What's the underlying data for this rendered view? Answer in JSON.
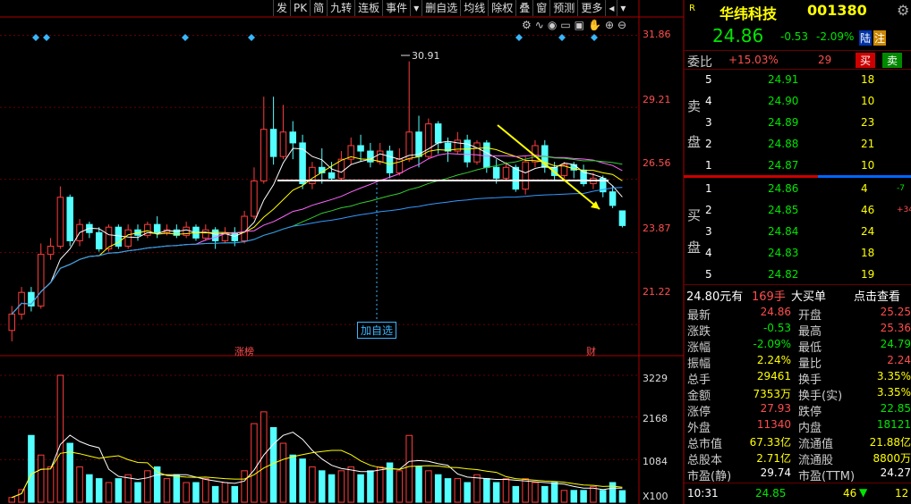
{
  "toolbar": {
    "items": [
      "发",
      "PK",
      "简",
      "九转",
      "连板",
      "事件",
      "▾",
      "删自选",
      "均线",
      "除权",
      "叠",
      "窗",
      "预测",
      "更多",
      "◂",
      "▾"
    ]
  },
  "chart_icons": [
    "gear-icon",
    "wave-icon",
    "eye-icon",
    "ruler-icon",
    "tool-icon",
    "hand-icon",
    "plus-icon",
    "minus-icon"
  ],
  "price_axis": [
    "31.86",
    "29.21",
    "26.56",
    "23.87",
    "21.22"
  ],
  "volume_axis": [
    "3229",
    "2168",
    "1084",
    "X100"
  ],
  "annotations": {
    "high_label": "30.91",
    "add_watch": "加自选",
    "limit_up": "涨榜",
    "finance": "财"
  },
  "stock": {
    "badge": "R",
    "name": "华纬科技",
    "code": "001380",
    "price": "24.86",
    "change": "-0.53",
    "pct": "-2.09%",
    "tag1": "陆",
    "tag2": "注"
  },
  "weibi": {
    "label": "委比",
    "value": "+15.03%",
    "diff": "29",
    "buy_btn": "买",
    "sell_btn": "卖"
  },
  "sell_label": [
    "卖",
    "盘"
  ],
  "buy_label": [
    "买",
    "盘"
  ],
  "sell_orders": [
    {
      "lvl": "5",
      "price": "24.91",
      "vol": "18"
    },
    {
      "lvl": "4",
      "price": "24.90",
      "vol": "10"
    },
    {
      "lvl": "3",
      "price": "24.89",
      "vol": "23"
    },
    {
      "lvl": "2",
      "price": "24.88",
      "vol": "21"
    },
    {
      "lvl": "1",
      "price": "24.87",
      "vol": "10"
    }
  ],
  "buy_orders": [
    {
      "lvl": "1",
      "price": "24.86",
      "vol": "4",
      "extra": "-7"
    },
    {
      "lvl": "2",
      "price": "24.85",
      "vol": "46",
      "extra": "+34"
    },
    {
      "lvl": "3",
      "price": "24.84",
      "vol": "24",
      "extra": ""
    },
    {
      "lvl": "4",
      "price": "24.83",
      "vol": "18",
      "extra": ""
    },
    {
      "lvl": "5",
      "price": "24.82",
      "vol": "19",
      "extra": ""
    }
  ],
  "big_order": {
    "price": "24.80元有",
    "qty": "169手",
    "type": "大买单",
    "link": "点击查看"
  },
  "stats": [
    {
      "k1": "最新",
      "v1": "24.86",
      "c1": "red",
      "k2": "开盘",
      "v2": "25.25",
      "c2": "red"
    },
    {
      "k1": "涨跌",
      "v1": "-0.53",
      "c1": "grn",
      "k2": "最高",
      "v2": "25.36",
      "c2": "red"
    },
    {
      "k1": "涨幅",
      "v1": "-2.09%",
      "c1": "grn",
      "k2": "最低",
      "v2": "24.79",
      "c2": "grn"
    },
    {
      "k1": "振幅",
      "v1": "2.24%",
      "c1": "yel",
      "k2": "量比",
      "v2": "2.24",
      "c2": "red"
    },
    {
      "k1": "总手",
      "v1": "29461",
      "c1": "yel",
      "k2": "换手",
      "v2": "3.35%",
      "c2": "yel"
    },
    {
      "k1": "金额",
      "v1": "7353万",
      "c1": "yel",
      "k2": "换手(实)",
      "v2": "3.35%",
      "c2": "yel"
    },
    {
      "k1": "涨停",
      "v1": "27.93",
      "c1": "red",
      "k2": "跌停",
      "v2": "22.85",
      "c2": "grn"
    },
    {
      "k1": "外盘",
      "v1": "11340",
      "c1": "red",
      "k2": "内盘",
      "v2": "18121",
      "c2": "grn"
    },
    {
      "k1": "总市值",
      "v1": "67.33亿",
      "c1": "yel",
      "k2": "流通值",
      "v2": "21.88亿",
      "c2": "yel"
    },
    {
      "k1": "总股本",
      "v1": "2.71亿",
      "c1": "yel",
      "k2": "流通股",
      "v2": "8800万",
      "c2": "yel"
    },
    {
      "k1": "市盈(静)",
      "v1": "29.74",
      "c1": "wht",
      "k2": "市盈(TTM)",
      "v2": "24.27",
      "c2": "wht"
    }
  ],
  "tick": {
    "time": "10:31",
    "price": "24.85",
    "vol": "46",
    "count": "12"
  },
  "chart_data": {
    "type": "candlestick",
    "ylim": [
      20.5,
      32.5
    ],
    "vol_max": 3229,
    "candles": [
      [
        21.0,
        21.6,
        20.6,
        21.9,
        120
      ],
      [
        21.6,
        22.4,
        21.4,
        22.6,
        320
      ],
      [
        22.4,
        21.9,
        21.7,
        22.6,
        1700
      ],
      [
        21.9,
        23.8,
        21.8,
        24.2,
        1200
      ],
      [
        23.8,
        24.1,
        23.6,
        24.4,
        900
      ],
      [
        24.1,
        25.9,
        24.0,
        26.3,
        3229
      ],
      [
        25.9,
        24.3,
        24.1,
        26.0,
        1500
      ],
      [
        24.3,
        24.9,
        24.1,
        25.1,
        900
      ],
      [
        24.9,
        24.6,
        24.4,
        25.0,
        700
      ],
      [
        24.6,
        24.0,
        23.9,
        24.8,
        600
      ],
      [
        24.0,
        24.8,
        23.9,
        24.9,
        500
      ],
      [
        24.8,
        24.1,
        24.0,
        24.9,
        600
      ],
      [
        24.1,
        24.7,
        24.0,
        24.9,
        700
      ],
      [
        24.7,
        24.5,
        24.3,
        24.9,
        500
      ],
      [
        24.5,
        24.9,
        24.4,
        25.0,
        800
      ],
      [
        24.9,
        24.6,
        24.4,
        25.2,
        900
      ],
      [
        24.6,
        24.7,
        24.5,
        24.9,
        600
      ],
      [
        24.7,
        24.5,
        24.4,
        24.9,
        700
      ],
      [
        24.5,
        24.8,
        24.4,
        25.0,
        500
      ],
      [
        24.8,
        24.4,
        24.3,
        24.9,
        500
      ],
      [
        24.4,
        24.7,
        24.3,
        24.9,
        600
      ],
      [
        24.7,
        24.3,
        24.0,
        24.8,
        400
      ],
      [
        24.3,
        24.6,
        24.2,
        24.8,
        500
      ],
      [
        24.6,
        24.3,
        24.1,
        24.8,
        400
      ],
      [
        24.3,
        25.2,
        24.2,
        25.4,
        800
      ],
      [
        25.2,
        26.5,
        25.1,
        27.0,
        2000
      ],
      [
        26.5,
        28.4,
        26.4,
        29.6,
        2300
      ],
      [
        28.4,
        27.4,
        27.1,
        29.6,
        1900
      ],
      [
        27.4,
        28.3,
        27.3,
        29.3,
        1500
      ],
      [
        28.3,
        27.9,
        27.3,
        28.7,
        1200
      ],
      [
        27.9,
        26.4,
        26.2,
        28.2,
        1100
      ],
      [
        26.4,
        27.0,
        26.2,
        27.2,
        900
      ],
      [
        27.0,
        26.8,
        26.4,
        27.7,
        800
      ],
      [
        26.8,
        26.6,
        26.5,
        27.2,
        700
      ],
      [
        26.6,
        27.3,
        26.5,
        27.6,
        800
      ],
      [
        27.3,
        27.8,
        27.1,
        28.1,
        900
      ],
      [
        27.8,
        27.6,
        27.2,
        28.2,
        700
      ],
      [
        27.6,
        27.2,
        27.0,
        27.9,
        800
      ],
      [
        27.2,
        27.6,
        27.1,
        27.9,
        900
      ],
      [
        27.6,
        26.8,
        26.6,
        27.8,
        1000
      ],
      [
        26.8,
        27.3,
        26.7,
        27.7,
        800
      ],
      [
        27.3,
        28.3,
        27.2,
        30.9,
        1700
      ],
      [
        28.3,
        27.4,
        27.0,
        28.9,
        900
      ],
      [
        27.4,
        28.6,
        27.3,
        28.8,
        800
      ],
      [
        28.6,
        27.9,
        27.5,
        28.7,
        700
      ],
      [
        27.9,
        27.6,
        27.2,
        28.1,
        600
      ],
      [
        27.6,
        28.0,
        27.5,
        28.3,
        600
      ],
      [
        28.0,
        27.2,
        27.0,
        28.2,
        500
      ],
      [
        27.2,
        27.9,
        27.1,
        28.0,
        700
      ],
      [
        27.9,
        27.0,
        26.8,
        28.0,
        600
      ],
      [
        27.0,
        26.6,
        26.4,
        27.3,
        500
      ],
      [
        26.6,
        27.0,
        26.5,
        27.2,
        600
      ],
      [
        27.0,
        26.2,
        26.1,
        27.1,
        400
      ],
      [
        26.2,
        27.2,
        26.0,
        27.4,
        600
      ],
      [
        27.2,
        27.8,
        27.0,
        28.0,
        500
      ],
      [
        27.8,
        27.0,
        26.8,
        28.0,
        400
      ],
      [
        27.0,
        26.7,
        26.5,
        27.2,
        500
      ],
      [
        26.7,
        27.1,
        26.6,
        27.2,
        300
      ],
      [
        27.1,
        26.9,
        26.6,
        27.2,
        300
      ],
      [
        26.9,
        26.4,
        26.3,
        27.1,
        300
      ],
      [
        26.4,
        26.6,
        26.2,
        26.8,
        400
      ],
      [
        26.6,
        26.1,
        25.9,
        26.7,
        300
      ],
      [
        26.1,
        25.6,
        25.5,
        26.3,
        500
      ],
      [
        25.4,
        24.86,
        24.79,
        25.36,
        295
      ]
    ]
  }
}
